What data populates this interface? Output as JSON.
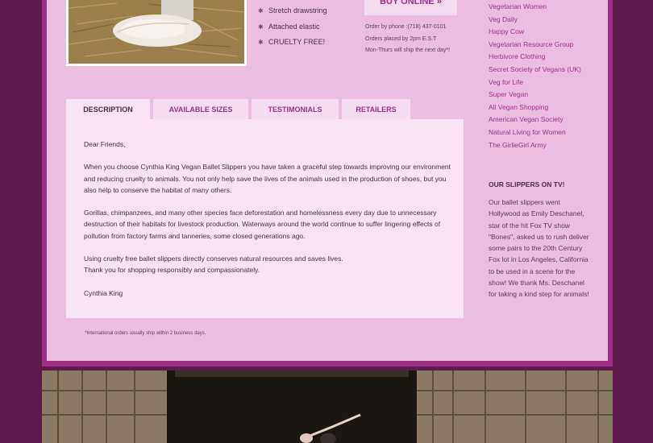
{
  "features": [
    "Stretch drawstring",
    "Attached elastic",
    "CRUELTY FREE!"
  ],
  "buy_online": "BUY ONLINE »",
  "order_info": {
    "phone": "Order by phone :(718) 437-0101",
    "cutoff": "Orders placed by 2pm E.S.T",
    "ship": "Mon-Thurs will ship the next day*!"
  },
  "tabs": [
    "DESCRIPTION",
    "AVAILABLE SIZES",
    "TESTIMONIALS",
    "RETAILERS"
  ],
  "description": {
    "greeting": "Dear Friends,",
    "p1": "When you choose Cynthia King Vegan Ballet Slippers you have taken a graceful step towards improving our environment and reducing cruelty to animals. You not only help save the lives of the animals used in the production of shoes, but you also help to conserve the habitat of many others.",
    "p2": "Gorillas, chimpanzees, and many other species face deforestation and homelessness every day due to unnecessary destruction of their habitats for livestock production. Waterways around the world continue to suffer lingering effects of pollution from factory farms and tanneries, some closed generations ago.",
    "p3a": "Using cruelty free ballet slippers directly conserves natural resources and saves lives.",
    "p3b": "Thank you for shopping responsibly and compassionately.",
    "signature": "Cynthia King"
  },
  "footnote": "*International orders usually ship within 2 business days.",
  "links": [
    "Vegetarian Women",
    "Veg Daily",
    "Happy Cow",
    "Vegetarian Resource Group",
    "Herbivore Clothing",
    "Secret Society of Vegans (UK)",
    "Veg for Life",
    "Super Vegan",
    "All Vegan Shopping",
    "American Vegan Society",
    "Natural Living for Women",
    "The GirlieGirl Army"
  ],
  "tv": {
    "heading": "OUR SLIPPERS ON TV!",
    "text": "Our ballet slippers went Hollywood as Emily Deschanel, star of the hit Fox TV show \"Bones\", asked us to rush deliver some pairs to the 20th Century Fox lot in Los Angeles, California to be used in a scene for the show!  We thank Ms. Deschanel for taking a kind step for animals!"
  },
  "colors": {
    "background": "#5e1c4e",
    "frame": "#a02d88",
    "panel": "#ebbedf",
    "content": "#f8e3f2",
    "link": "#a02d88"
  }
}
